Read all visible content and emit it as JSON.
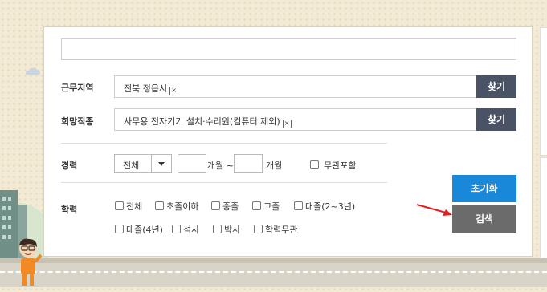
{
  "top_input": {
    "value": ""
  },
  "work_region": {
    "label": "근무지역",
    "value": "전북 정읍시",
    "find_label": "찾기"
  },
  "desired_job": {
    "label": "희망직종",
    "value": "사무용 전자기기 설치·수리원(컴퓨터 제외)",
    "find_label": "찾기"
  },
  "career": {
    "label": "경력",
    "select_value": "전체",
    "from_value": "",
    "from_unit": "개월 ~",
    "to_value": "",
    "to_unit": "개월",
    "any_label": "무관포함"
  },
  "education": {
    "label": "학력",
    "options": [
      "전체",
      "초졸이하",
      "중졸",
      "고졸",
      "대졸(2~3년)",
      "대졸(4년)",
      "석사",
      "박사",
      "학력무관"
    ]
  },
  "buttons": {
    "reset": "초기화",
    "search": "검색"
  },
  "colors": {
    "reset": "#1a88d9",
    "search": "#6b6b6b",
    "find": "#4a5266",
    "arrow": "#e02020"
  }
}
